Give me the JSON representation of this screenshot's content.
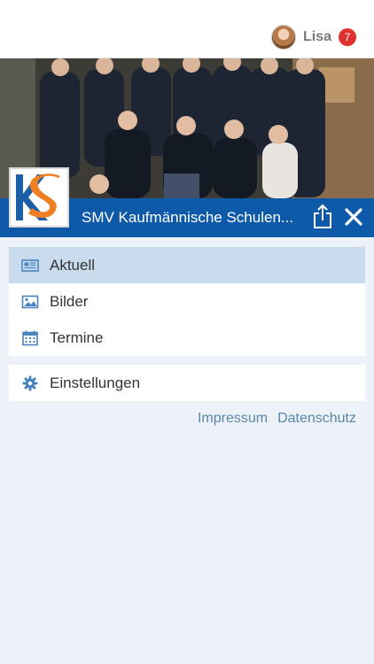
{
  "header": {
    "user_name": "Lisa",
    "notification_count": "7"
  },
  "group": {
    "title": "SMV Kaufmännische Schulen...",
    "logo_icon": "ks-logo-icon",
    "actions": {
      "share_icon": "share-icon",
      "close_icon": "close-icon"
    }
  },
  "menu": {
    "items": [
      {
        "label": "Aktuell",
        "icon": "newspaper-icon",
        "active": true
      },
      {
        "label": "Bilder",
        "icon": "image-icon",
        "active": false
      },
      {
        "label": "Termine",
        "icon": "calendar-icon",
        "active": false
      }
    ],
    "settings": {
      "label": "Einstellungen",
      "icon": "gear-icon"
    }
  },
  "footer": {
    "impressum": "Impressum",
    "datenschutz": "Datenschutz"
  },
  "colors": {
    "primary": "#0e5aa8",
    "active_item": "#c9dcee",
    "link": "#5a86a8",
    "badge": "#e1312f",
    "background": "#edf2f8"
  }
}
